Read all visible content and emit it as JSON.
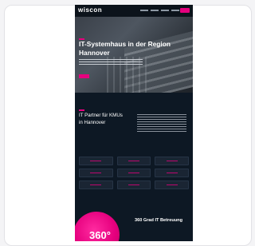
{
  "site": {
    "logo": "wiscon",
    "nav_links": [
      "",
      "",
      "",
      ""
    ],
    "nav_cta": ""
  },
  "hero": {
    "title": "IT-Systemhaus in der Region Hannover",
    "subtitle": "",
    "button": ""
  },
  "partner": {
    "title": "IT Partner für KMUs in Hannover",
    "text": ""
  },
  "services": {
    "tiles": [
      "",
      "",
      "",
      "",
      "",
      "",
      "",
      "",
      ""
    ]
  },
  "support": {
    "badge": "360°",
    "title": "360 Grad IT Betreuung"
  },
  "colors": {
    "accent": "#e6007e",
    "background": "#0d1824"
  }
}
